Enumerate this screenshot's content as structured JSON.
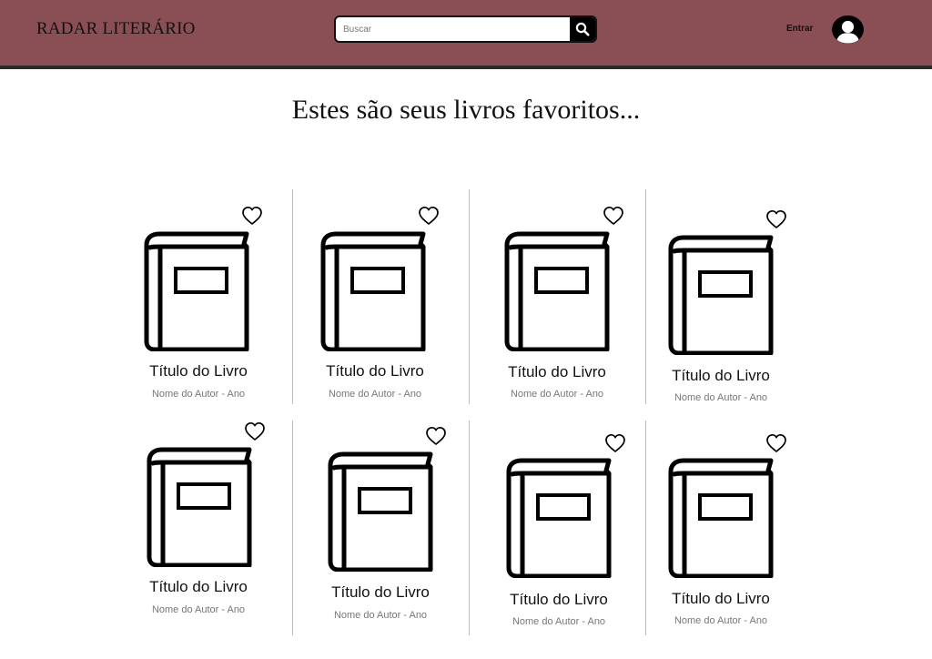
{
  "header": {
    "logo": "RADAR LITERÁRIO",
    "search_placeholder": "Buscar",
    "login_label": "Entrar"
  },
  "main": {
    "title": "Estes são seus livros favoritos..."
  },
  "books": [
    {
      "title": "Título do Livro",
      "meta": "Nome do Autor - Ano"
    },
    {
      "title": "Título do Livro",
      "meta": "Nome do Autor - Ano"
    },
    {
      "title": "Título do Livro",
      "meta": "Nome do Autor - Ano"
    },
    {
      "title": "Título do Livro",
      "meta": "Nome do Autor - Ano"
    },
    {
      "title": "Título do Livro",
      "meta": "Nome do Autor - Ano"
    },
    {
      "title": "Título do Livro",
      "meta": "Nome do Autor - Ano"
    },
    {
      "title": "Título do Livro",
      "meta": "Nome do Autor - Ano"
    },
    {
      "title": "Título do Livro",
      "meta": "Nome do Autor - Ano"
    }
  ],
  "icons": {
    "search": "search-icon",
    "avatar": "user-avatar-icon",
    "favorite": "heart-outline-icon",
    "book": "book-icon"
  },
  "colors": {
    "header_bg": "#8a4f55",
    "header_border": "#2b2b2b",
    "text": "#111111",
    "meta_text": "#777777"
  }
}
